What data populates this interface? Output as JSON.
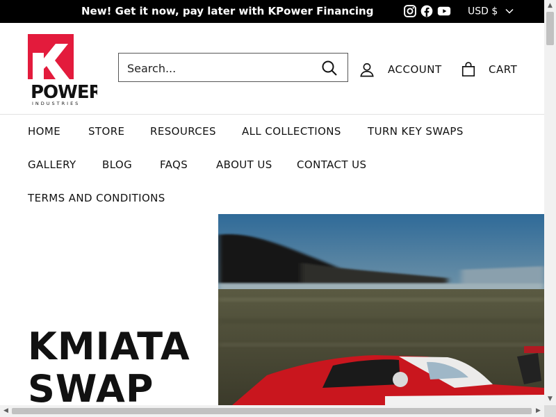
{
  "announcement": {
    "text": "New! Get it now, pay later with KPower Financing",
    "social_icons": [
      "instagram-icon",
      "facebook-icon",
      "youtube-icon"
    ],
    "currency": "USD $"
  },
  "header": {
    "logo": {
      "letter": "K",
      "brand": "POWER",
      "tagline": "INDUSTRIES",
      "brand_color": "#e31b3c"
    },
    "search_placeholder": "Search...",
    "account_label": "ACCOUNT",
    "cart_label": "CART"
  },
  "nav": {
    "items": [
      {
        "label": "HOME"
      },
      {
        "label": "STORE"
      },
      {
        "label": "RESOURCES"
      },
      {
        "label": "ALL COLLECTIONS"
      },
      {
        "label": "TURN KEY SWAPS"
      },
      {
        "label": "GALLERY"
      },
      {
        "label": "BLOG"
      },
      {
        "label": "FAQS"
      },
      {
        "label": "ABOUT US"
      },
      {
        "label": "CONTACT US"
      },
      {
        "label": "TERMS AND CONDITIONS"
      }
    ]
  },
  "hero": {
    "title_line1": "KMIATA",
    "title_line2": "SWAP"
  },
  "colors": {
    "announcement_bg": "#000000",
    "accent": "#e31b3c",
    "text": "#111111"
  }
}
